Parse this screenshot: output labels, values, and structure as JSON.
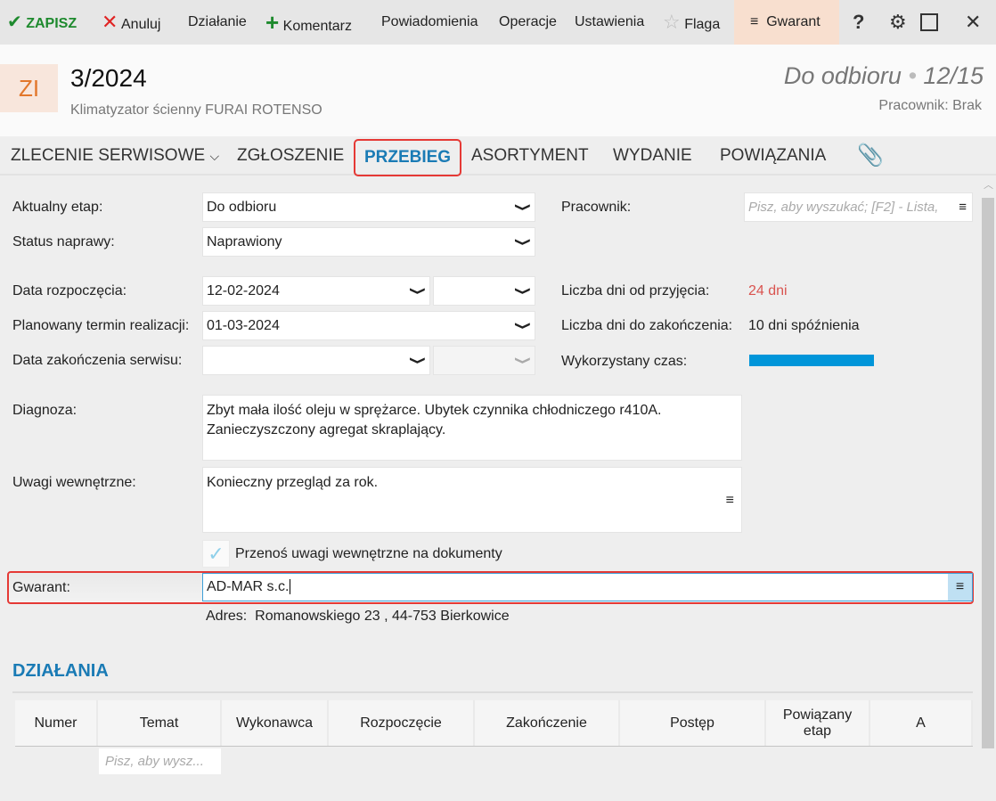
{
  "toolbar": {
    "save": "ZAPISZ",
    "cancel": "Anuluj",
    "action": "Działanie",
    "comment": "Komentarz",
    "notifications": "Powiadomienia",
    "operations": "Operacje",
    "settings": "Ustawienia",
    "flag": "Flaga",
    "gwarant": "Gwarant",
    "help": "?"
  },
  "header": {
    "badge": "ZI",
    "number": "3/2024",
    "subtitle": "Klimatyzator ścienny FURAI ROTENSO",
    "status": "Do odbioru",
    "separator": "•",
    "progress": "12/15",
    "employee": "Pracownik: Brak"
  },
  "tabs": [
    "ZLECENIE SERWISOWE",
    "ZGŁOSZENIE",
    "PRZEBIEG",
    "ASORTYMENT",
    "WYDANIE",
    "POWIĄZANIA"
  ],
  "form": {
    "stage_label": "Aktualny etap:",
    "stage_value": "Do odbioru",
    "repair_label": "Status naprawy:",
    "repair_value": "Naprawiony",
    "start_label": "Data rozpoczęcia:",
    "start_value": "12-02-2024",
    "planned_label": "Planowany termin realizacji:",
    "planned_value": "01-03-2024",
    "end_label": "Data zakończenia serwisu:",
    "end_value": "",
    "employee_label": "Pracownik:",
    "employee_placeholder": "Pisz, aby wyszukać; [F2] - Lista,",
    "days_since_label": "Liczba dni od przyjęcia:",
    "days_since_value": "24 dni",
    "days_to_label": "Liczba dni do zakończenia:",
    "days_to_value": "10 dni spóźnienia",
    "time_used_label": "Wykorzystany czas:",
    "time_used_fraction": 1.0,
    "diagnosis_label": "Diagnoza:",
    "diagnosis_value": "Zbyt mała ilość oleju w sprężarce. Ubytek czynnika chłodniczego r410A. Zanieczyszczony agregat skraplający.",
    "notes_label": "Uwagi wewnętrzne:",
    "notes_value": "Konieczny przegląd za rok.",
    "transfer_label": "Przenoś uwagi wewnętrzne na dokumenty",
    "guarantor_label": "Gwarant:",
    "guarantor_value": "AD-MAR s.c.",
    "address_label": "Adres:",
    "address_value": "Romanowskiego 23 , 44-753 Bierkowice"
  },
  "actions": {
    "title": "DZIAŁANIA",
    "columns": [
      "Numer",
      "Temat",
      "Wykonawca",
      "Rozpoczęcie",
      "Zakończenie",
      "Postęp",
      "Powiązany etap",
      "A"
    ],
    "filter_placeholder": "Pisz, aby wysz..."
  },
  "colors": {
    "accent": "#1a7bb5",
    "save": "#1e8a2e",
    "cancel": "#e02424",
    "warning": "#d9534f",
    "bar": "#0095d9",
    "highlight": "#f8dfcf"
  }
}
